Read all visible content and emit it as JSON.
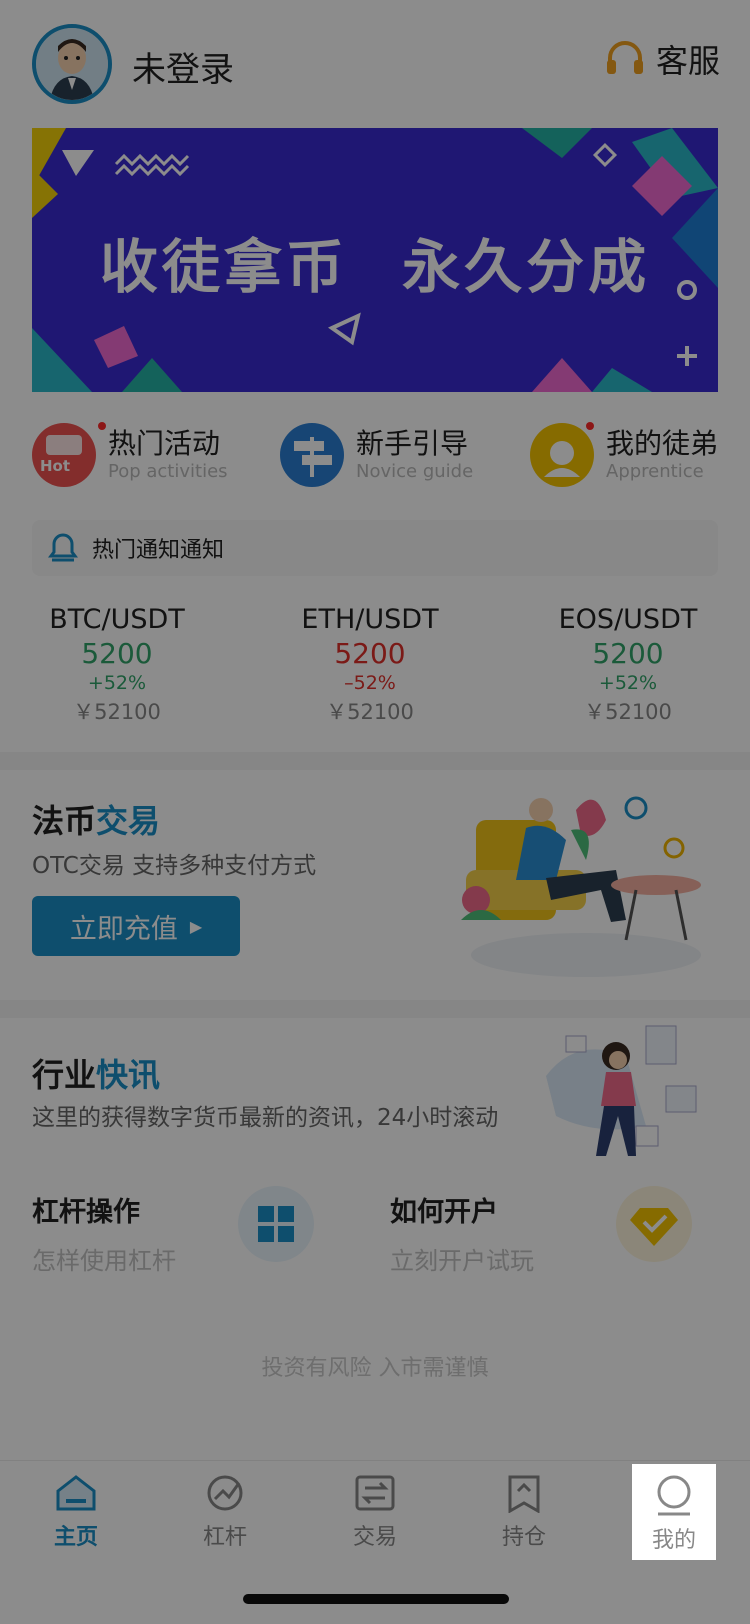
{
  "header": {
    "login_status": "未登录",
    "service_label": "客服"
  },
  "banner": {
    "text": "收徒拿币 永久分成"
  },
  "quick_links": [
    {
      "title": "热门活动",
      "subtitle": "Pop activities",
      "icon": "hot-activity-icon",
      "badge_text": "Hot"
    },
    {
      "title": "新手引导",
      "subtitle": "Novice guide",
      "icon": "signpost-icon"
    },
    {
      "title": "我的徒弟",
      "subtitle": "Apprentice",
      "icon": "apprentice-icon"
    }
  ],
  "notice": {
    "text": "热门通知通知"
  },
  "tickers": [
    {
      "pair": "BTC/USDT",
      "price": "5200",
      "change": "+52%",
      "cny": "￥52100",
      "trend": "up"
    },
    {
      "pair": "ETH/USDT",
      "price": "5200",
      "change": "–52%",
      "cny": "￥52100",
      "trend": "down"
    },
    {
      "pair": "EOS/USDT",
      "price": "5200",
      "change": "+52%",
      "cny": "￥52100",
      "trend": "up"
    }
  ],
  "fiat": {
    "title_part1": "法币",
    "title_part2": "交易",
    "subtitle": "OTC交易 支持多种支付方式",
    "button": "立即充值"
  },
  "news": {
    "title_part1": "行业",
    "title_part2": "快讯",
    "subtitle": "这里的获得数字货币最新的资讯，24小时滚动"
  },
  "cards": [
    {
      "title": "杠杆操作",
      "subtitle": "怎样使用杠杆"
    },
    {
      "title": "如何开户",
      "subtitle": "立刻开户试玩"
    }
  ],
  "risk_notice": "投资有风险 入市需谨慎",
  "tabs": [
    {
      "label": "主页",
      "icon": "home-icon",
      "active": true
    },
    {
      "label": "杠杆",
      "icon": "leverage-icon",
      "active": false
    },
    {
      "label": "交易",
      "icon": "trade-icon",
      "active": false
    },
    {
      "label": "持仓",
      "icon": "position-icon",
      "active": false
    },
    {
      "label": "我的",
      "icon": "profile-icon",
      "active": false
    }
  ],
  "colors": {
    "accent": "#1a8fc6",
    "up": "#32a56a",
    "down": "#e0312b",
    "banner": "#3a2bd1"
  }
}
